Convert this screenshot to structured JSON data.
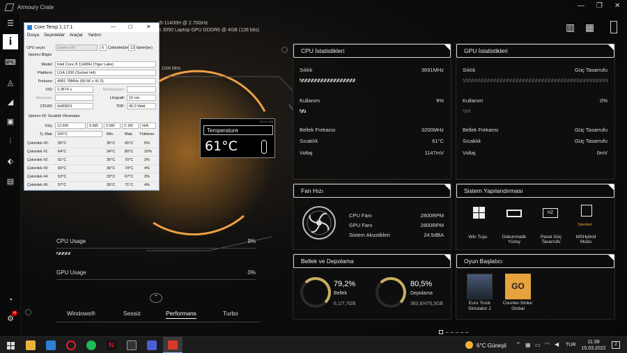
{
  "app": {
    "title": "Armoury Crate"
  },
  "sysinfo": {
    "line1": "i5-11400H @ 2.70GHz",
    "line2": "k 3050 Laptop GPU GDDR6 @ 4GB (128 bits)"
  },
  "coretemp": {
    "title": "Core Temp 1.17.1",
    "menu": [
      "Dosya",
      "Seçenekler",
      "Araçlar",
      "Yardım"
    ],
    "cpu_select_label": "CPU seçin:",
    "cpu_select_value": "İşlemci #0",
    "cores": "6",
    "cores_label": "Çekirdek(ler)",
    "threads": "12",
    "threads_label": "İşlem(ler)",
    "section_info": "İşlemci Bilgisi",
    "model_label": "Model:",
    "model": "Intel Core i5 11400H (Tiger Lake)",
    "platform_label": "Platform:",
    "platform": "LGA 1200 (Socket H4)",
    "freq_label": "Frekans:",
    "freq": "4081.78MHz (99.56 x 41.0)",
    "vid_label": "VID:",
    "vid": "1.0674 v",
    "mod_label": "Modülasyon:",
    "rev_label": "Revizyon:",
    "litho_label": "Litografi:",
    "litho": "10 nm",
    "cpuid_label": "CPUID:",
    "cpuid": "0x806D1",
    "tdp_label": "TDP:",
    "tdp": "45.0 Watt",
    "section_temps": "İşlemci #0: Sıcaklık Okumaları",
    "power_label": "Güç:",
    "power": [
      "12.6W",
      "9.6W",
      "0.9W",
      "2.1W",
      "N/A"
    ],
    "tjmax_label": "Tj. Mak:",
    "tjmax": "100°C",
    "col_min": "Min.",
    "col_max": "Mak.",
    "col_load": "Yükleme",
    "rows": [
      {
        "name": "Çekirdek #0:",
        "temp": "55°C",
        "min": "35°C",
        "max": "65°C",
        "load": "5%"
      },
      {
        "name": "Çekirdek #1:",
        "temp": "64°C",
        "min": "34°C",
        "max": "80°C",
        "load": "10%"
      },
      {
        "name": "Çekirdek #2:",
        "temp": "61°C",
        "min": "36°C",
        "max": "70°C",
        "load": "3%"
      },
      {
        "name": "Çekirdek #3:",
        "temp": "60°C",
        "min": "36°C",
        "max": "74°C",
        "load": "4%"
      },
      {
        "name": "Çekirdek #4:",
        "temp": "53°C",
        "min": "33°C",
        "max": "67°C",
        "load": "3%"
      },
      {
        "name": "Çekirdek #5:",
        "temp": "57°C",
        "min": "35°C",
        "max": "71°C",
        "load": "4%"
      }
    ]
  },
  "widget": {
    "freq_tag": "1000 MHz",
    "temp_label": "Temperature",
    "temp_value": "61°C",
    "tag": "0.0.0 / 206"
  },
  "left_usage": {
    "cpu_label": "CPU Usage",
    "cpu_value": "9%",
    "cpu_fraction": 0.09,
    "gpu_label": "GPU Usage",
    "gpu_value": "0%",
    "gpu_fraction": 0.0
  },
  "modes": [
    "Windows®",
    "Sessiz",
    "Performans",
    "Turbo"
  ],
  "cpu_stats": {
    "title": "CPU İstatistikleri",
    "freq_label": "Sıklık",
    "freq": "3691MHz",
    "freq_fraction": 0.8,
    "usage_label": "Kullanım",
    "usage": "9%",
    "usage_fraction": 0.09,
    "memfreq_label": "Bellek Frekansı",
    "memfreq": "3200MHz",
    "temp_label": "Sıcaklık",
    "temp": "61°C",
    "volt_label": "Voltaj",
    "volt": "1147mV"
  },
  "gpu_stats": {
    "title": "GPU İstatistikleri",
    "freq_label": "Sıklık",
    "freq": "Güç Tasarrufu",
    "freq_fraction": 0.0,
    "usage_label": "Kullanım",
    "usage": "0%",
    "usage_fraction": 0.0,
    "memfreq_label": "Bellek Frekansı",
    "memfreq": "Güç Tasarrufu",
    "temp_label": "Sıcaklık",
    "temp": "Güç Tasarrufu",
    "volt_label": "Voltaj",
    "volt": "0mV"
  },
  "fan": {
    "title": "Fan Hızı",
    "cpu_label": "CPU Fanı",
    "cpu": "2800RPM",
    "gpu_label": "GPU Fanı",
    "gpu": "2800RPM",
    "acoustic_label": "Sistem Akustikleri",
    "acoustic": "24.5dBA"
  },
  "config": {
    "title": "Sistem Yapılandırması",
    "items": [
      "Win Tuşu",
      "Dokunmatik Yüzey",
      "Panel Güç Tasarrufu",
      "MSHybrid Modu"
    ],
    "mshybrid_state": "Standart",
    "panel_icon_text": "HZ"
  },
  "memory": {
    "title": "Bellek ve Depolama",
    "mem_pct": "79,2%",
    "mem_label": "Bellek",
    "mem_detail": "6,1/7,7GB",
    "disk_pct": "80,5%",
    "disk_label": "Depolama",
    "disk_detail": "383,6/476,3GB"
  },
  "games": {
    "title": "Oyun Başlatıcı",
    "items": [
      "Euro Truck Simulator 2",
      "Counter-Strike: Global"
    ],
    "cs_icon_text": "GO"
  },
  "taskbar": {
    "weather": "6°C  Güneşli",
    "lang": "TUR",
    "time": "11:39",
    "date": "15.03.2022",
    "notif_count": "2",
    "app_badge": "H"
  }
}
